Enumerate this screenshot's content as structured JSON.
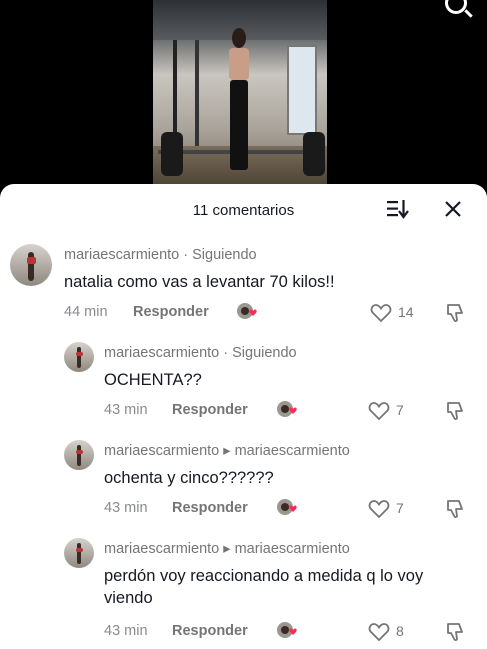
{
  "header": {
    "count_label": "11 comentarios"
  },
  "comments": [
    {
      "username": "mariaescarmiento · Siguiendo",
      "text": "natalia como vas a levantar 70 kilos!!",
      "time": "44 min",
      "reply_label": "Responder",
      "likes": "14"
    },
    {
      "username": "mariaescarmiento · Siguiendo",
      "text": "OCHENTA??",
      "time": "43 min",
      "reply_label": "Responder",
      "likes": "7"
    },
    {
      "username": "mariaescarmiento ▸ mariaescarmiento",
      "text": "ochenta y cinco??????",
      "time": "43 min",
      "reply_label": "Responder",
      "likes": "7"
    },
    {
      "username": "mariaescarmiento ▸ mariaescarmiento",
      "text": "perdón voy reaccionando a medida q lo voy viendo",
      "time": "43 min",
      "reply_label": "Responder",
      "likes": "8"
    }
  ],
  "icons": {
    "search": "search-icon",
    "sort": "sort-icon",
    "close": "close-icon",
    "like": "heart-outline-icon",
    "dislike": "thumbs-down-icon",
    "reaction": "creator-liked-icon"
  },
  "colors": {
    "accent_heart": "#fe2c55",
    "text_primary": "#161823",
    "text_secondary": "#757575"
  }
}
